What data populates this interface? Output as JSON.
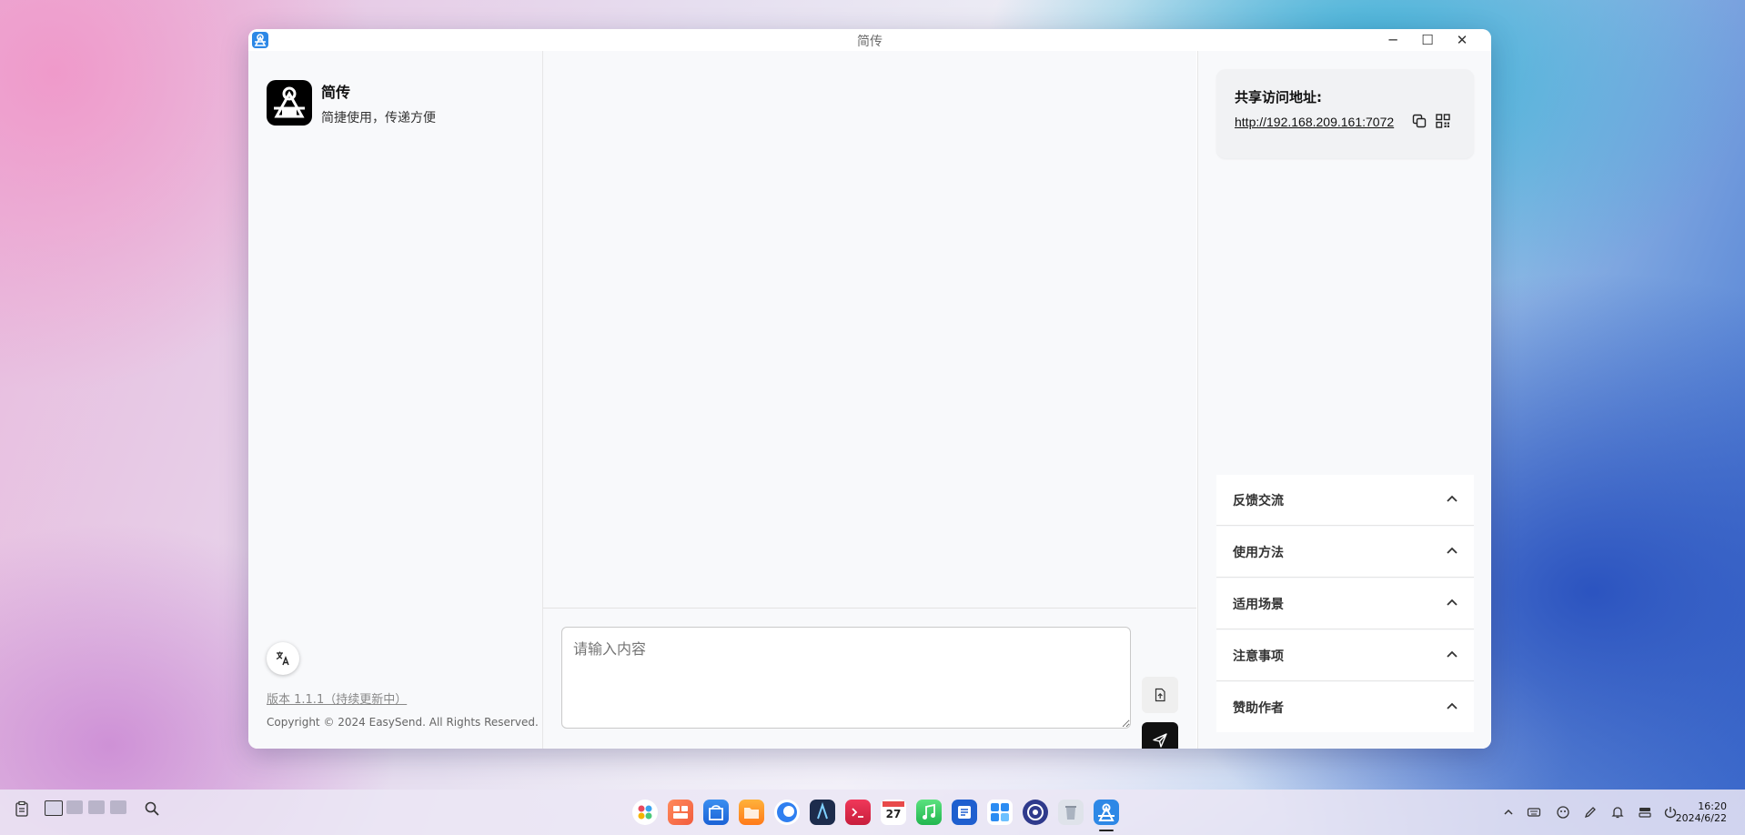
{
  "window": {
    "title": "简传",
    "controls": {
      "minimize": "─",
      "maximize": "☐",
      "close": "✕"
    }
  },
  "sidebar": {
    "app_name": "简传",
    "tagline": "简捷使用，传递方便",
    "version": "版本 1.1.1（持续更新中）",
    "copyright": "Copyright © 2024 EasySend. All Rights Reserved."
  },
  "composer": {
    "placeholder": "请输入内容"
  },
  "share": {
    "label": "共享访问地址:",
    "url": "http://192.168.209.161:7072"
  },
  "accordion": [
    {
      "label": "反馈交流"
    },
    {
      "label": "使用方法"
    },
    {
      "label": "适用场景"
    },
    {
      "label": "注意事项"
    },
    {
      "label": "赞助作者"
    }
  ],
  "taskbar": {
    "time": "16:20",
    "date": "2024/6/22",
    "calendar_day": "27"
  },
  "colors": {
    "accent": "#2d88e6",
    "send_button": "#111111",
    "panel_bg": "#f8f9fb"
  }
}
